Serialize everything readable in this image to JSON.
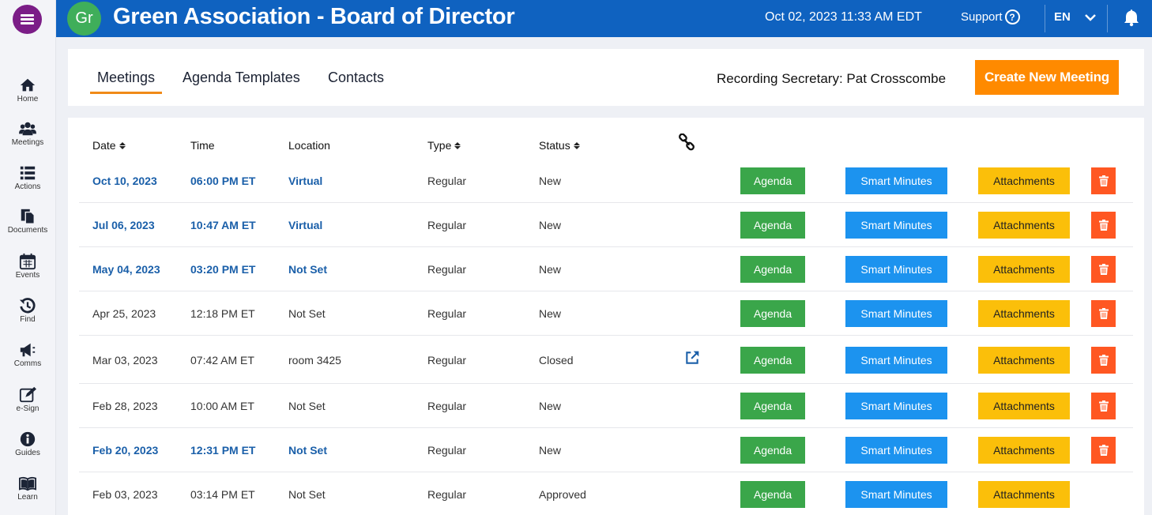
{
  "sidebar": {
    "items": [
      {
        "label": "Home",
        "icon": "home-icon"
      },
      {
        "label": "Meetings",
        "icon": "users-icon"
      },
      {
        "label": "Actions",
        "icon": "list-icon"
      },
      {
        "label": "Documents",
        "icon": "documents-icon"
      },
      {
        "label": "Events",
        "icon": "calendar-icon"
      },
      {
        "label": "Find",
        "icon": "history-icon"
      },
      {
        "label": "Comms",
        "icon": "megaphone-icon"
      },
      {
        "label": "e-Sign",
        "icon": "sign-icon"
      },
      {
        "label": "Guides",
        "icon": "info-icon"
      },
      {
        "label": "Learn",
        "icon": "book-icon"
      }
    ]
  },
  "header": {
    "avatar": "Gr",
    "title": "Green Association - Board of Director",
    "datetime": "Oct 02, 2023 11:33 AM  EDT",
    "support": "Support",
    "language": "EN",
    "colors": {
      "bar": "#0f62c0",
      "avatar": "#3fae5a"
    }
  },
  "tabs": {
    "items": [
      "Meetings",
      "Agenda Templates",
      "Contacts"
    ],
    "active": "Meetings",
    "secretary": "Recording Secretary: Pat Crosscombe",
    "create_button": "Create New Meeting"
  },
  "table": {
    "columns": [
      "Date",
      "Time",
      "Location",
      "Type",
      "Status"
    ],
    "buttons": {
      "agenda": "Agenda",
      "minutes": "Smart Minutes",
      "attachments": "Attachments"
    },
    "rows": [
      {
        "date": "Oct 10, 2023",
        "time": "06:00 PM ET",
        "location": "Virtual",
        "type": "Regular",
        "status": "New",
        "linked": true,
        "external": false,
        "deletable": true
      },
      {
        "date": "Jul 06, 2023",
        "time": "10:47 AM ET",
        "location": "Virtual",
        "type": "Regular",
        "status": "New",
        "linked": true,
        "external": false,
        "deletable": true
      },
      {
        "date": "May 04, 2023",
        "time": "03:20 PM ET",
        "location": "Not Set",
        "type": "Regular",
        "status": "New",
        "linked": true,
        "external": false,
        "deletable": true
      },
      {
        "date": "Apr 25, 2023",
        "time": "12:18 PM ET",
        "location": "Not Set",
        "type": "Regular",
        "status": "New",
        "linked": false,
        "external": false,
        "deletable": true
      },
      {
        "date": "Mar 03, 2023",
        "time": "07:42 AM ET",
        "location": "room 3425",
        "type": "Regular",
        "status": "Closed",
        "linked": false,
        "external": true,
        "deletable": true
      },
      {
        "date": "Feb 28, 2023",
        "time": "10:00 AM ET",
        "location": "Not Set",
        "type": "Regular",
        "status": "New",
        "linked": false,
        "external": false,
        "deletable": true
      },
      {
        "date": "Feb 20, 2023",
        "time": "12:31 PM ET",
        "location": "Not Set",
        "type": "Regular",
        "status": "New",
        "linked": true,
        "external": false,
        "deletable": true
      },
      {
        "date": "Feb 03, 2023",
        "time": "03:14 PM ET",
        "location": "Not Set",
        "type": "Regular",
        "status": "Approved",
        "linked": false,
        "external": false,
        "deletable": false
      }
    ]
  }
}
